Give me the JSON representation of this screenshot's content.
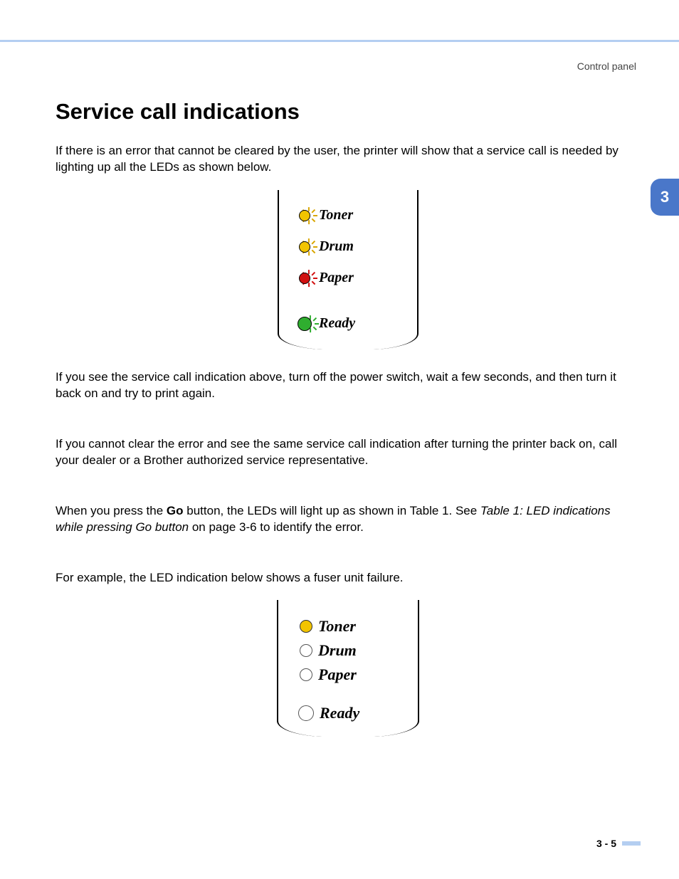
{
  "header": {
    "section": "Control panel"
  },
  "chapter": {
    "number": "3"
  },
  "title": "Service call indications",
  "paragraphs": {
    "p1": "If there is an error that cannot be cleared by the user, the printer will show that a service call is needed by lighting up all the LEDs as shown below.",
    "p2": "If you see the service call indication above, turn off the power switch, wait a few seconds, and then turn it back on and try to print again.",
    "p3": "If you cannot clear the error and see the same service call indication after turning the printer back on, call your dealer or a Brother authorized service representative.",
    "p4a": "When you press the ",
    "p4_go": "Go",
    "p4b": " button, the LEDs will light up as shown in Table 1. See ",
    "p4_ref": "Table 1: LED indications while pressing Go button",
    "p4c": " on page 3-6 to identify the error.",
    "p5": "For example, the LED indication below shows a fuser unit failure."
  },
  "panel1": {
    "leds": {
      "toner": "Toner",
      "drum": "Drum",
      "paper": "Paper",
      "ready": "Ready"
    }
  },
  "panel2": {
    "leds": {
      "toner": "Toner",
      "drum": "Drum",
      "paper": "Paper",
      "ready": "Ready"
    }
  },
  "footer": {
    "page": "3 - 5"
  }
}
